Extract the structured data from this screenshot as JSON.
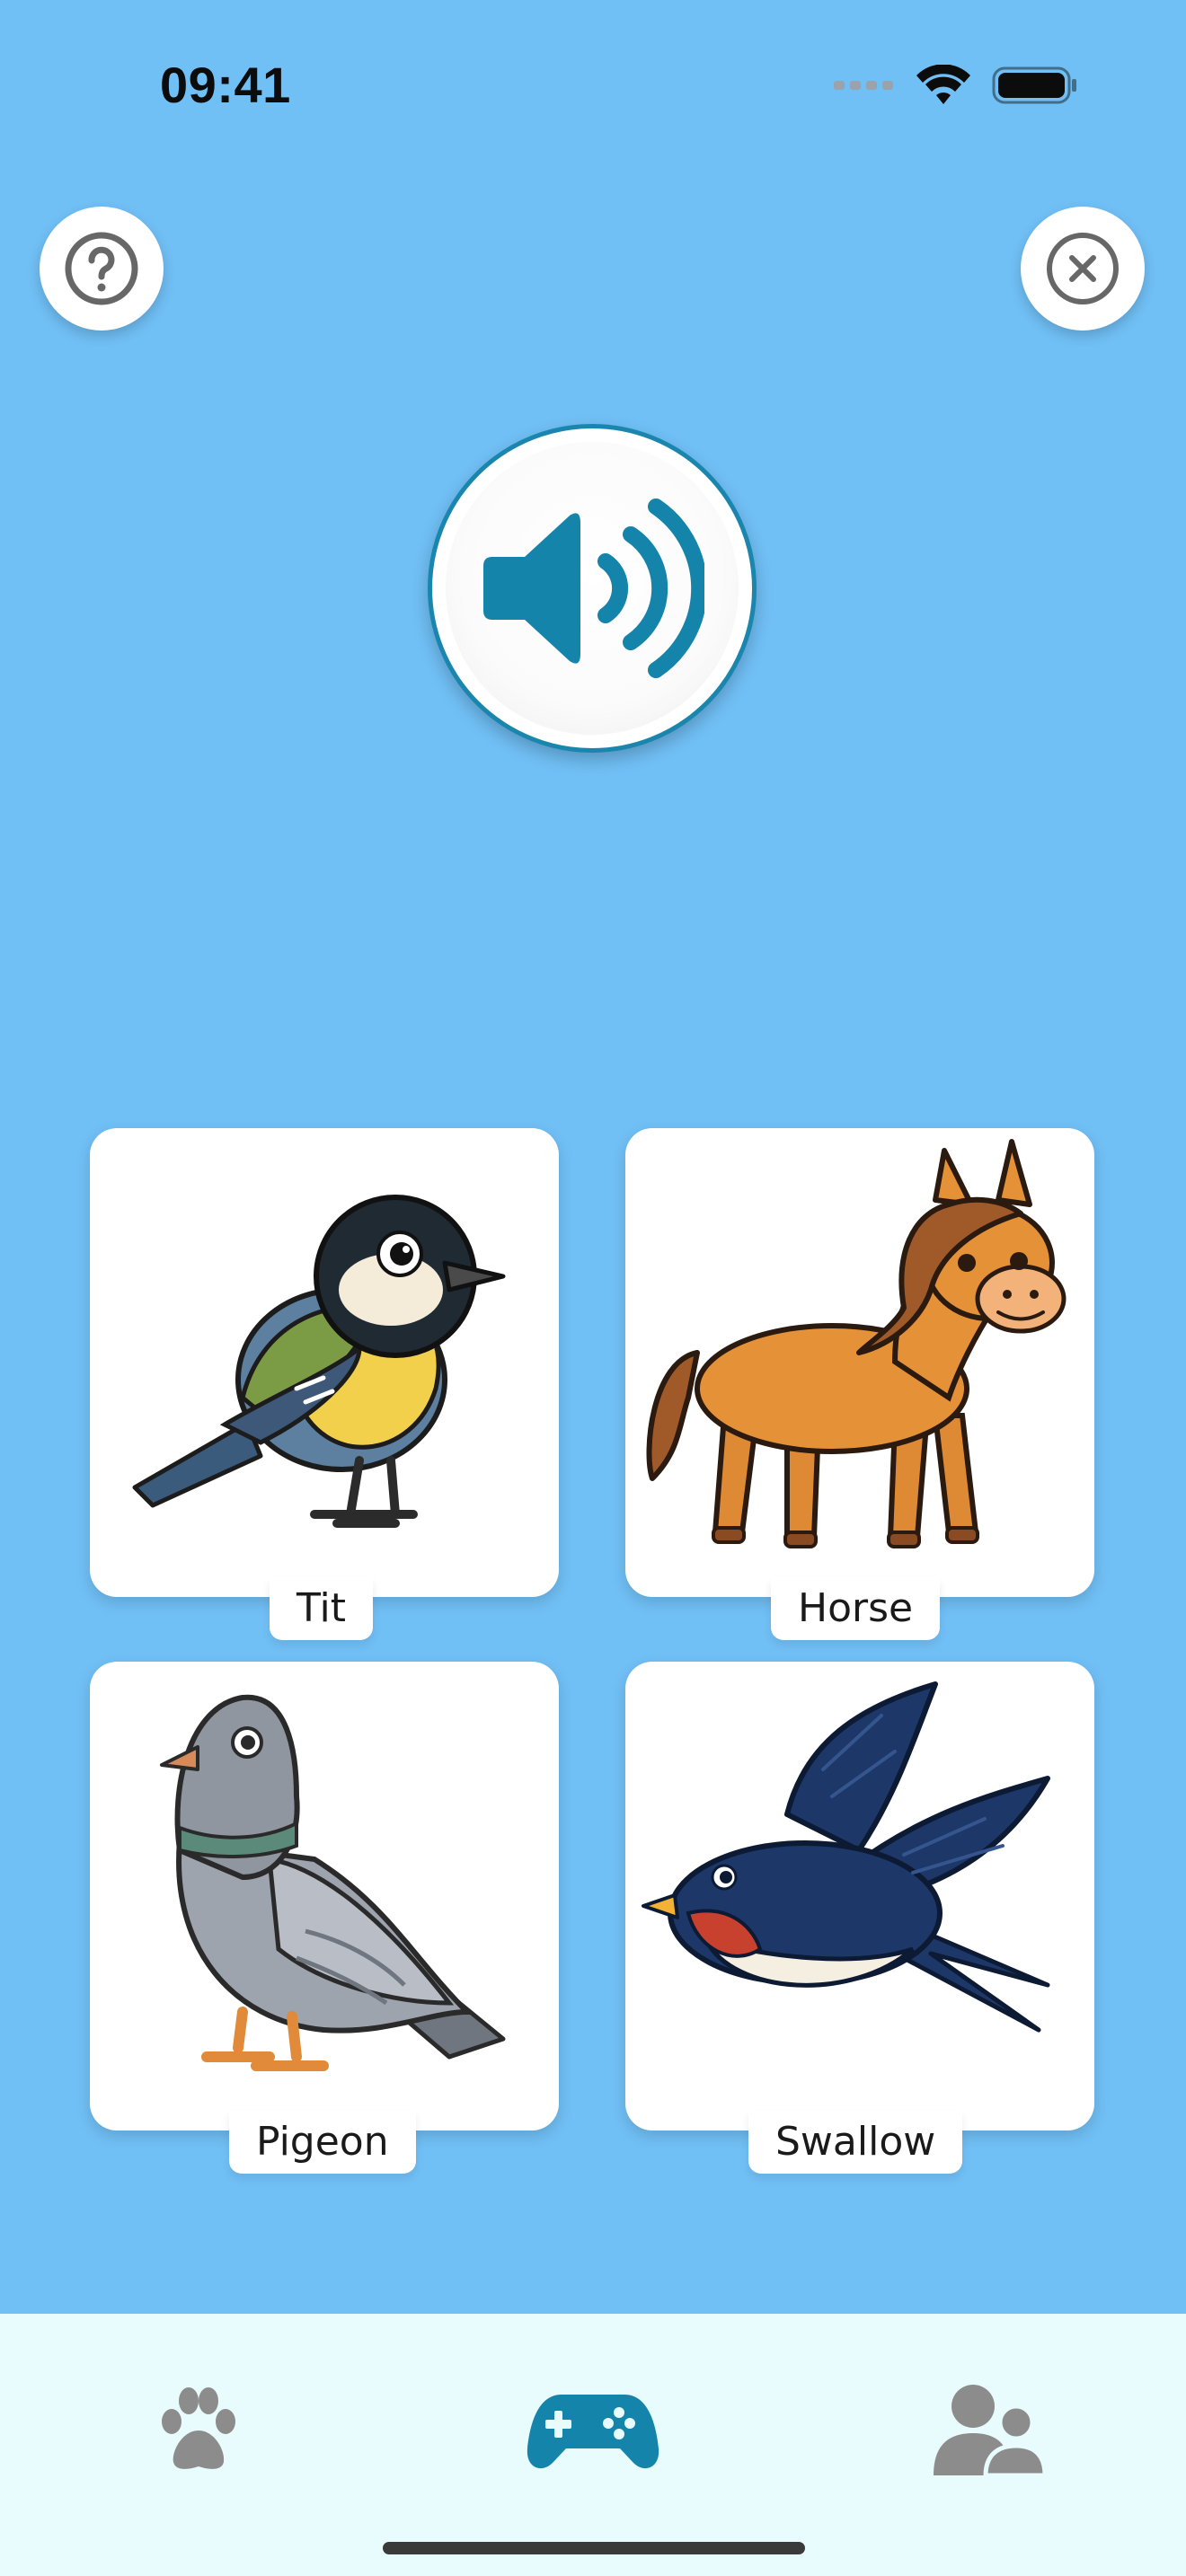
{
  "status_bar": {
    "time": "09:41"
  },
  "top_buttons": {
    "help_icon": "question-circle-icon",
    "close_icon": "close-circle-icon"
  },
  "speaker": {
    "icon": "speaker-volume-icon",
    "accent": "#1A86AE"
  },
  "cards": [
    {
      "label": "Tit",
      "icon": "tit-bird-illustration"
    },
    {
      "label": "Horse",
      "icon": "horse-illustration"
    },
    {
      "label": "Pigeon",
      "icon": "pigeon-illustration"
    },
    {
      "label": "Swallow",
      "icon": "swallow-illustration"
    }
  ],
  "tab_bar": {
    "tabs": [
      {
        "icon": "paw-icon",
        "active": false
      },
      {
        "icon": "gamepad-icon",
        "active": true
      },
      {
        "icon": "users-icon",
        "active": false
      }
    ],
    "active_color": "#1A86AE",
    "inactive_color": "#8C8C8C"
  },
  "colors": {
    "background": "#70BFF5",
    "tabbar_background": "#E8FBFD"
  }
}
